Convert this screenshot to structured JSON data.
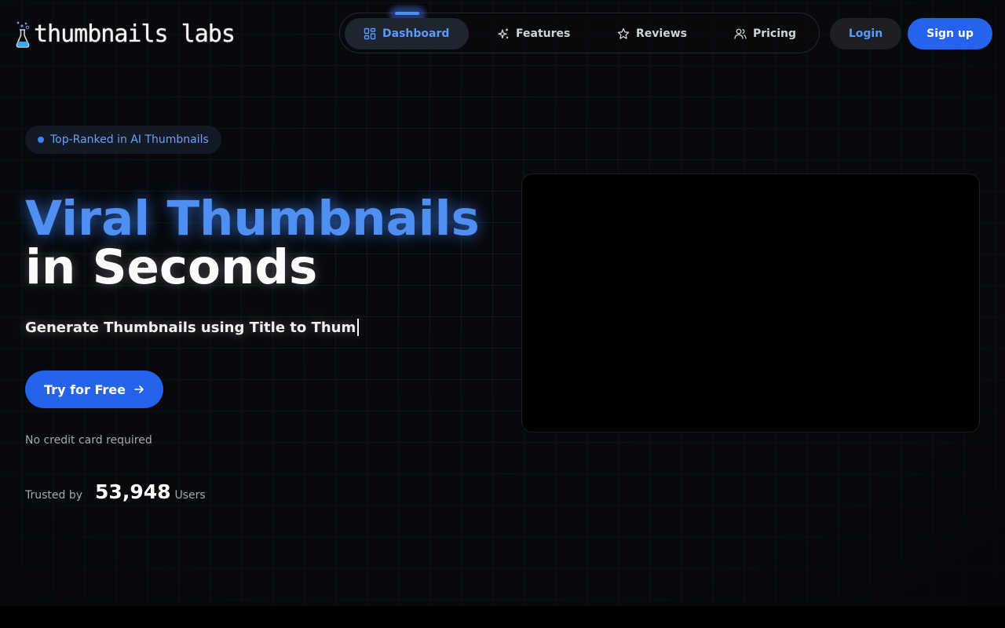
{
  "brand": {
    "name": "thumbnails labs",
    "icon": "flask-icon"
  },
  "nav": {
    "items": [
      {
        "label": "Dashboard",
        "icon": "grid-icon",
        "active": true
      },
      {
        "label": "Features",
        "icon": "sparkles-icon",
        "active": false
      },
      {
        "label": "Reviews",
        "icon": "star-icon",
        "active": false
      },
      {
        "label": "Pricing",
        "icon": "users-icon",
        "active": false
      }
    ]
  },
  "auth": {
    "login_label": "Login",
    "signup_label": "Sign up"
  },
  "hero": {
    "badge": "Top-Ranked in AI Thumbnails",
    "title_line1": "Viral Thumbnails",
    "title_line2": "in Seconds",
    "subtitle": "Generate Thumbnails using Title to Thum",
    "cta_label": "Try for Free",
    "cta_icon": "arrow-right-icon",
    "note": "No credit card required",
    "trusted_label": "Trusted by",
    "trusted_count": "53,948",
    "trusted_unit": "Users"
  },
  "colors": {
    "accent": "#2563eb",
    "accent_text": "#5b9bf8",
    "background": "#07090d"
  }
}
